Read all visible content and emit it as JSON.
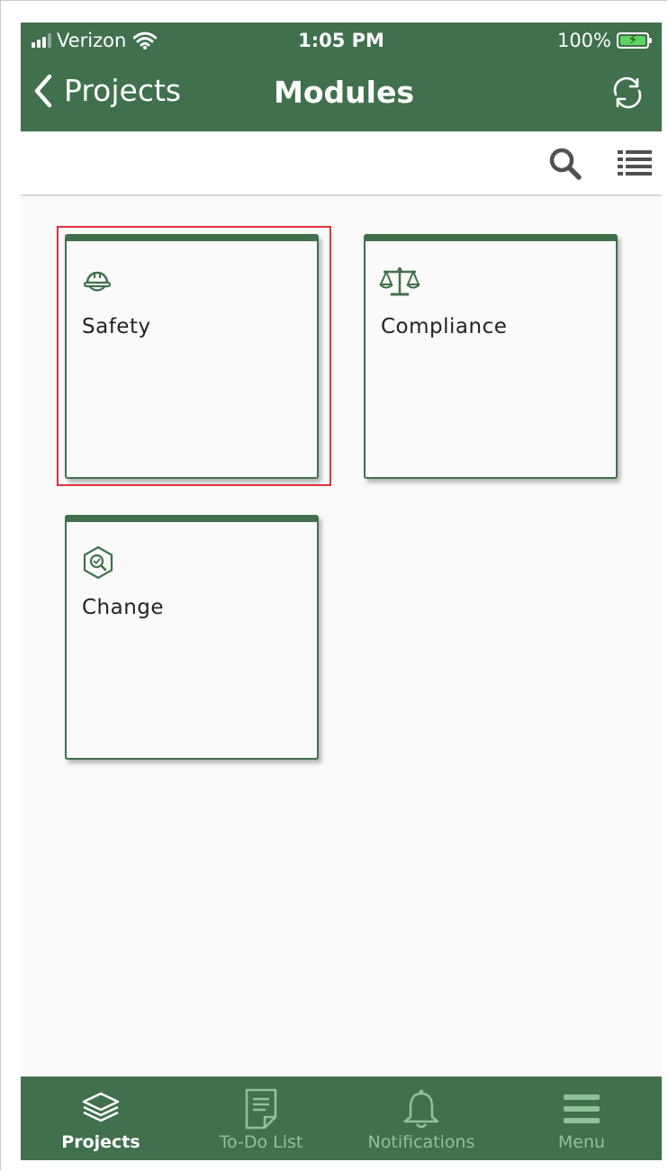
{
  "status_bar": {
    "carrier": "Verizon",
    "time": "1:05 PM",
    "battery": "100%"
  },
  "nav": {
    "back_label": "Projects",
    "title": "Modules"
  },
  "modules": [
    {
      "label": "Safety",
      "icon": "hard-hat-icon"
    },
    {
      "label": "Compliance",
      "icon": "scales-icon"
    },
    {
      "label": "Change",
      "icon": "change-search-icon"
    }
  ],
  "tabs": [
    {
      "label": "Projects",
      "icon": "layers-icon",
      "active": true
    },
    {
      "label": "To-Do List",
      "icon": "document-icon",
      "active": false
    },
    {
      "label": "Notifications",
      "icon": "bell-icon",
      "active": false
    },
    {
      "label": "Menu",
      "icon": "hamburger-icon",
      "active": false
    }
  ],
  "colors": {
    "brand_green": "#41704c",
    "inactive_tab_text": "#8fc29a",
    "highlight_red": "#e0313a",
    "background": "#f9f9f9"
  }
}
